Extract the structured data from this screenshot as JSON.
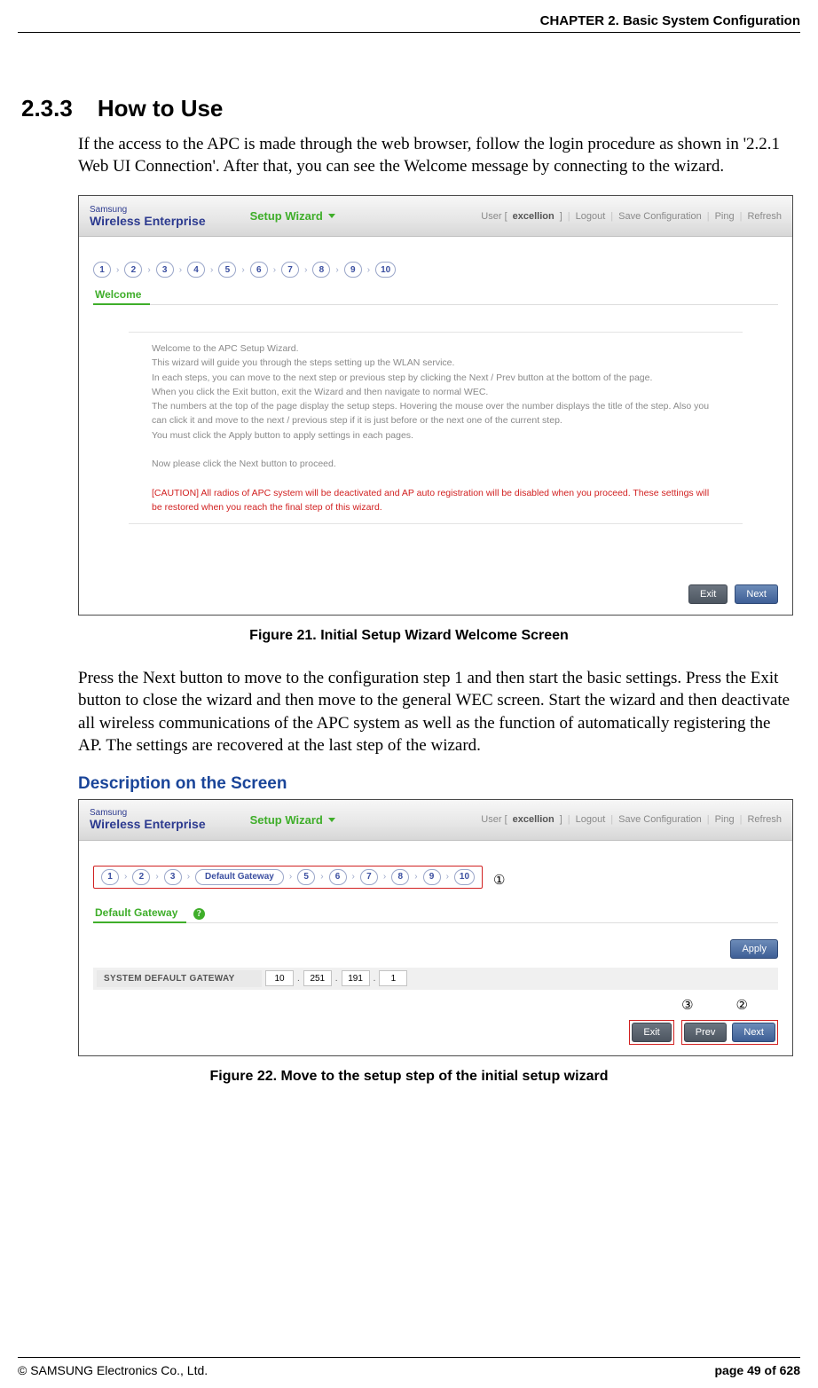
{
  "running_head": "CHAPTER 2. Basic System Configuration",
  "section": {
    "number": "2.3.3",
    "title": "How to Use"
  },
  "intro_paragraph": "If the access to the APC is made through the web browser, follow the login procedure as shown in '2.2.1 Web UI Connection'. After that, you can see the Welcome message by connecting to the wizard.",
  "figure1": {
    "header": {
      "logo_top": "Samsung",
      "logo_bottom": "Wireless Enterprise",
      "setup_wizard": "Setup Wizard",
      "user_prefix": "User [",
      "user_name": "excellion",
      "user_suffix": "]",
      "logout": "Logout",
      "save_config": "Save Configuration",
      "ping": "Ping",
      "refresh": "Refresh"
    },
    "steps": [
      "1",
      "2",
      "3",
      "4",
      "5",
      "6",
      "7",
      "8",
      "9",
      "10"
    ],
    "tab_label": "Welcome",
    "welcome_lines": [
      "Welcome to the APC Setup Wizard.",
      "This wizard will guide you through the steps setting up the WLAN service.",
      "In each steps, you can move to the next step or previous step by clicking the Next / Prev button at the bottom of the page.",
      "When you click the Exit button, exit the Wizard and then navigate to normal WEC.",
      "The numbers at the top of the page display the setup steps. Hovering the mouse over the number displays the title of the step. Also you can click it and move to the next / previous step if it is just before or the next one of the current step.",
      "You must click the Apply button to apply settings in each pages."
    ],
    "welcome_proceed": "Now please click the Next button to proceed.",
    "welcome_caution": "[CAUTION] All radios of APC system will be deactivated and AP auto registration will be disabled when you proceed. These settings will be restored when you reach the final step of this wizard.",
    "buttons": {
      "exit": "Exit",
      "next": "Next"
    }
  },
  "figure1_caption": "Figure 21. Initial Setup Wizard Welcome Screen",
  "mid_paragraph": "Press the Next button to move to the configuration step 1 and then start the basic settings. Press the Exit button to close the wizard and then move to the general WEC screen. Start the wizard and then deactivate all wireless communications of the APC system as well as the function of automatically registering the AP. The settings are recovered at the last step of the wizard.",
  "sub_heading": "Description on the Screen",
  "figure2": {
    "header": {
      "logo_top": "Samsung",
      "logo_bottom": "Wireless Enterprise",
      "setup_wizard": "Setup Wizard",
      "user_prefix": "User [",
      "user_name": "excellion",
      "user_suffix": "]",
      "logout": "Logout",
      "save_config": "Save Configuration",
      "ping": "Ping",
      "refresh": "Refresh"
    },
    "steps_before": [
      "1",
      "2",
      "3"
    ],
    "step_current": "Default Gateway",
    "steps_after": [
      "5",
      "6",
      "7",
      "8",
      "9",
      "10"
    ],
    "callout1": "①",
    "tab_label": "Default Gateway",
    "help_symbol": "?",
    "apply": "Apply",
    "gateway_label": "SYSTEM DEFAULT GATEWAY",
    "ip": [
      "10",
      "251",
      "191",
      "1"
    ],
    "callout3": "③",
    "callout2": "②",
    "buttons": {
      "exit": "Exit",
      "prev": "Prev",
      "next": "Next"
    }
  },
  "figure2_caption": "Figure 22. Move to the setup step of the initial setup wizard",
  "footer": {
    "left": "© SAMSUNG Electronics Co., Ltd.",
    "right": "page 49 of 628"
  }
}
